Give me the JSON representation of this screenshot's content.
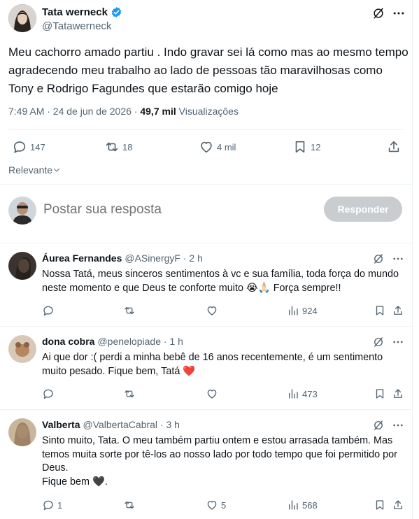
{
  "tweet": {
    "author_name": "Tata werneck",
    "author_handle": "@Tatawerneck",
    "text": "Meu cachorro amado partiu . Indo gravar sei lá como mas ao mesmo tempo agradecendo meu trabalho ao lado de pessoas tão maravilhosas como Tony e Rodrigo Fagundes que estarão comigo hoje",
    "time": "7:49 AM · 24 de jun de 2026 · ",
    "views_count": "49,7 mil",
    "views_label": " Visualizações",
    "replies": "147",
    "retweets": "18",
    "likes": "4 mil",
    "bookmarks": "12"
  },
  "sort": {
    "label": "Relevante"
  },
  "composer": {
    "placeholder": "Postar sua resposta",
    "button": "Responder"
  },
  "replies": [
    {
      "name": "Áurea Fernandes",
      "handle": "@ASinergyF · 2 h",
      "text": "Nossa Tatá, meus sinceros sentimentos à vc e sua família, toda força do mundo neste momento e que Deus te conforte muito 😭🙏🏻 Força sempre!!",
      "replies": "",
      "retweets": "",
      "likes": "",
      "views": "924"
    },
    {
      "name": "dona cobra",
      "handle": "@penelopiade · 1 h",
      "text": "Ai que dor :( perdi a minha bebê de 16 anos recentemente, é um sentimento muito pesado. Fique bem, Tatá ❤️",
      "replies": "",
      "retweets": "",
      "likes": "",
      "views": "473"
    },
    {
      "name": "Valberta",
      "handle": "@ValbertaCabral · 3 h",
      "text": "Sinto muito, Tata. O meu também partiu ontem e estou arrasada também. Mas temos muita sorte por tê-los ao nosso lado por todo tempo que foi permitido por Deus.\nFique bem 🖤.",
      "replies": "1",
      "retweets": "",
      "likes": "5",
      "views": "568"
    }
  ],
  "colors": {
    "verified": "#1d9bf0",
    "text": "#0f1419",
    "secondary": "#536471",
    "button_disabled": "#c9cdd0"
  }
}
